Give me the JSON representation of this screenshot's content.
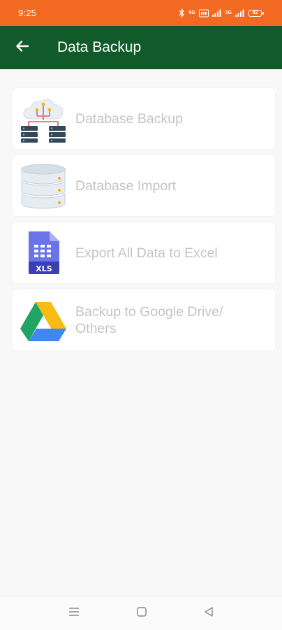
{
  "status_bar": {
    "time": "9:25",
    "network_label_1": "5G",
    "network_label_2": "5G",
    "battery_level": "82"
  },
  "app_bar": {
    "title": "Data Backup",
    "back_icon": "arrow-left-icon"
  },
  "menu": {
    "items": [
      {
        "label": "Database Backup",
        "icon": "cloud-server-icon"
      },
      {
        "label": "Database Import",
        "icon": "database-icon"
      },
      {
        "label": "Export All Data to Excel",
        "icon": "xls-file-icon"
      },
      {
        "label": "Backup to Google Drive/ Others",
        "icon": "google-drive-icon"
      }
    ]
  },
  "nav_bar": {
    "recents_icon": "menu-lines-icon",
    "home_icon": "square-home-icon",
    "back_icon": "triangle-back-icon"
  },
  "colors": {
    "status_bar": "#f26a22",
    "app_bar": "#115b2a",
    "background": "#f8f8f8",
    "label_text": "#c4c4c4"
  }
}
